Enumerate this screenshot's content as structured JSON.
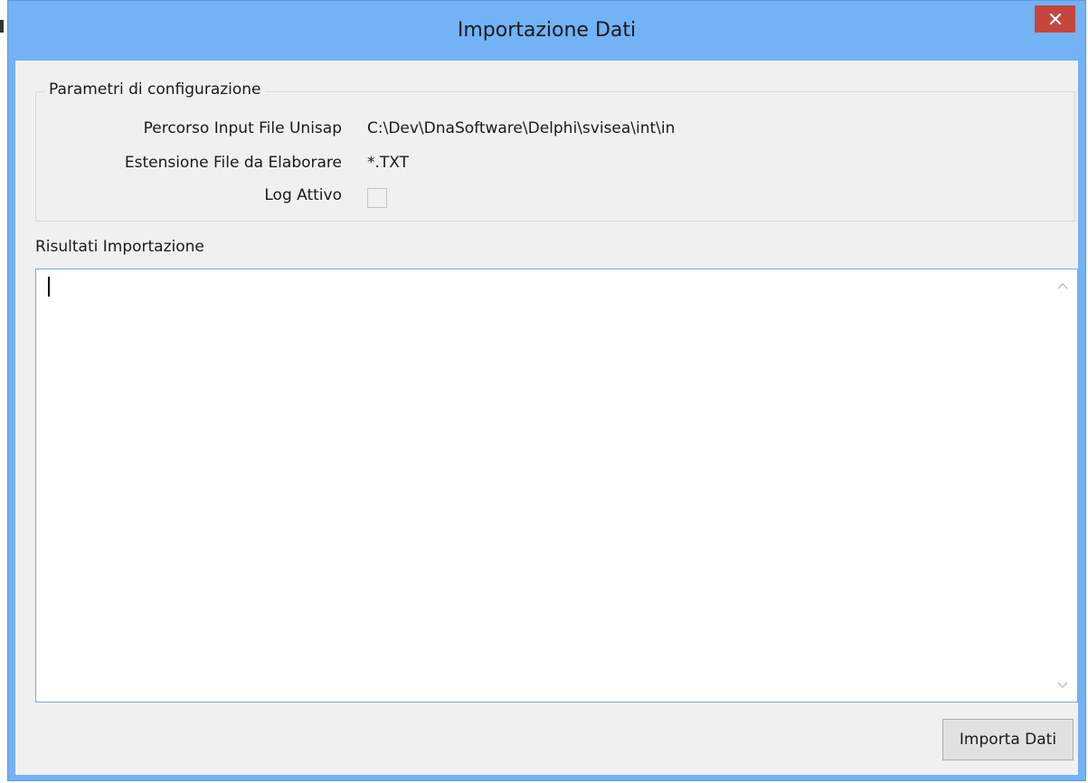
{
  "window": {
    "title": "Importazione Dati",
    "close_glyph": "✕",
    "accent_color": "#72b2f5",
    "close_color": "#c7463c"
  },
  "config_group": {
    "legend": "Parametri di configurazione",
    "rows": [
      {
        "label": "Percorso Input File Unisap",
        "value": "C:\\Dev\\DnaSoftware\\Delphi\\svisea\\int\\in"
      },
      {
        "label": "Estensione File da Elaborare",
        "value": "*.TXT"
      },
      {
        "label": "Log Attivo",
        "checked": false
      }
    ]
  },
  "results": {
    "label": "Risultati Importazione",
    "content": ""
  },
  "actions": {
    "import_label": "Importa Dati"
  }
}
